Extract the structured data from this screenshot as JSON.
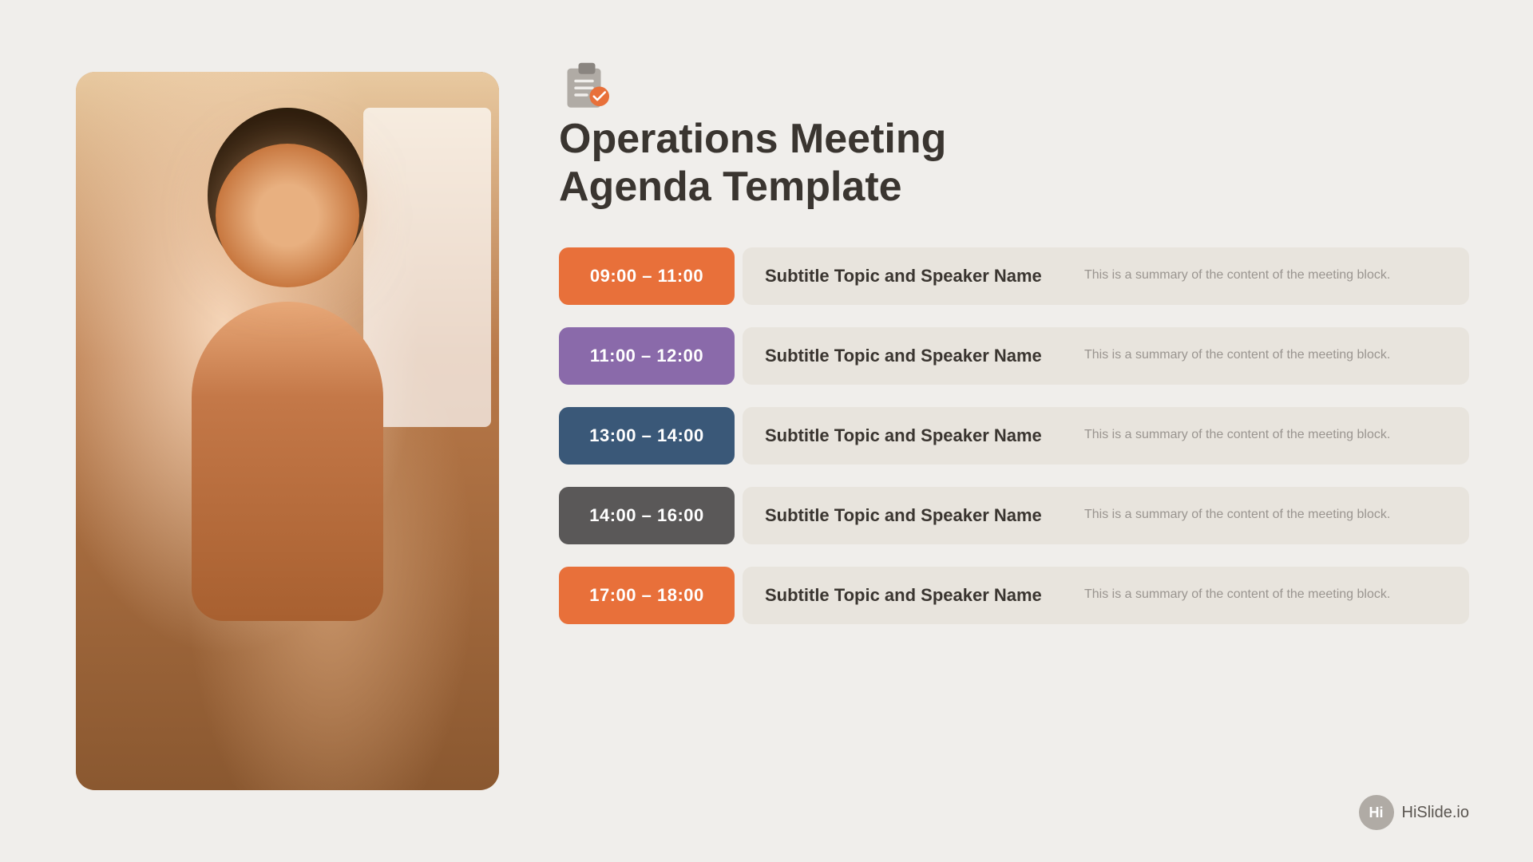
{
  "page": {
    "background_color": "#f0eeeb",
    "title": "Operations Meeting\nAgenda Template",
    "icon_label": "clipboard-checklist-icon"
  },
  "branding": {
    "circle_letter": "Hi",
    "site_name": "HiSlide.io"
  },
  "agenda_items": [
    {
      "time": "09:00 – 11:00",
      "color_class": "orange",
      "subtitle": "Subtitle Topic and Speaker Name",
      "summary": "This is a summary of the content of the meeting block."
    },
    {
      "time": "11:00 – 12:00",
      "color_class": "purple",
      "subtitle": "Subtitle Topic and Speaker Name",
      "summary": "This is a summary of the content of the meeting block."
    },
    {
      "time": "13:00 – 14:00",
      "color_class": "dark-blue",
      "subtitle": "Subtitle Topic and Speaker Name",
      "summary": "This is a summary of the content of the meeting block."
    },
    {
      "time": "14:00 – 16:00",
      "color_class": "dark-gray",
      "subtitle": "Subtitle Topic and Speaker Name",
      "summary": "This is a summary of the content of the meeting block."
    },
    {
      "time": "17:00 – 18:00",
      "color_class": "orange2",
      "subtitle": "Subtitle Topic and Speaker Name",
      "summary": "This is a summary of the content of the meeting block."
    }
  ]
}
